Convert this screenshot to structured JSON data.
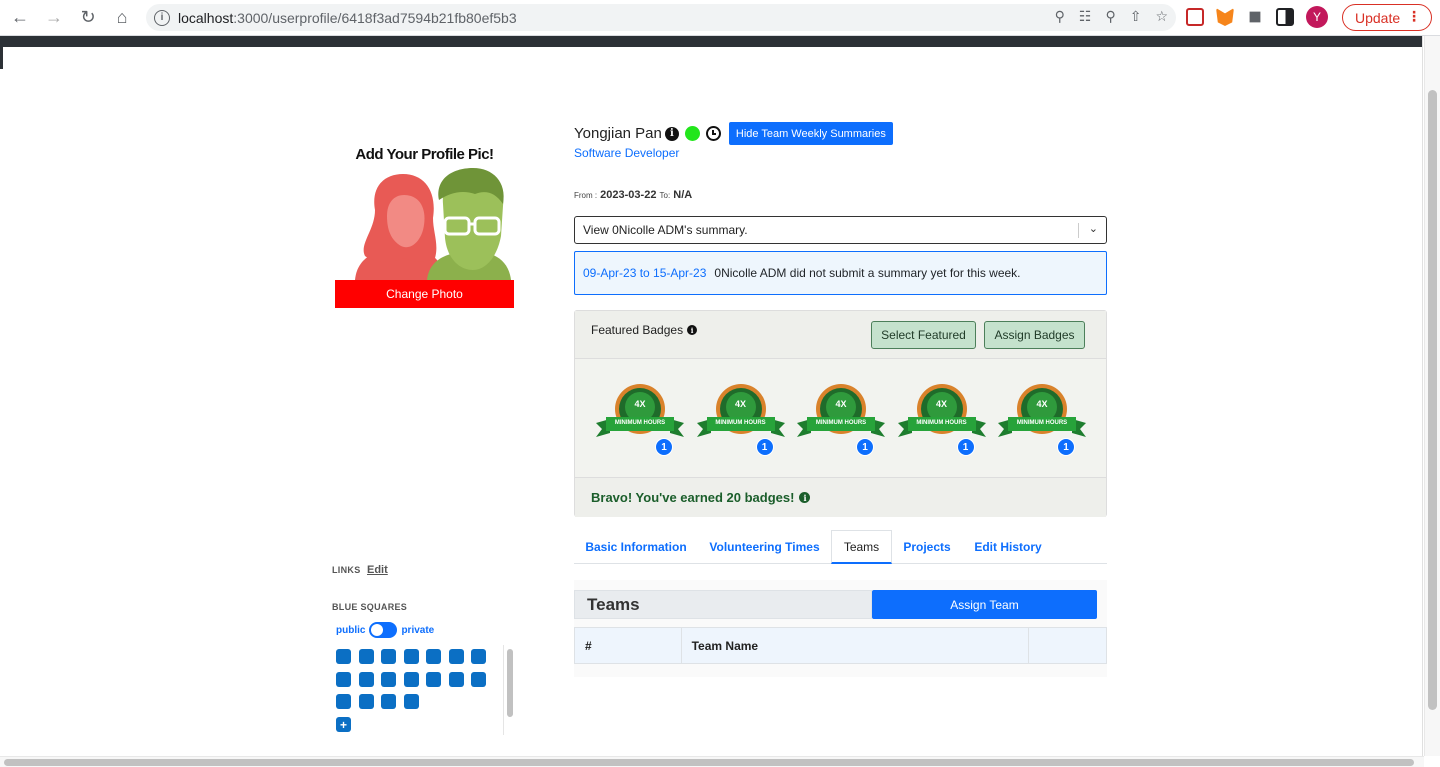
{
  "browser": {
    "url_host": "localhost",
    "url_path": ":3000/userprofile/6418f3ad7594b21fb80ef5b3",
    "avatar_letter": "Y",
    "update_label": "Update"
  },
  "profile": {
    "pic_title": "Add Your Profile Pic!",
    "change_photo_label": "Change Photo",
    "name": "Yongjian Pan",
    "role": "Software Developer",
    "hide_summaries_label": "Hide Team Weekly Summaries",
    "from_label": "From :",
    "from_date": "2023-03-22",
    "to_label": "To:",
    "to_date": "N/A",
    "status_color": "#22e61c"
  },
  "summary": {
    "select_value": "View 0Nicolle ADM's summary.",
    "range": "09-Apr-23 to 15-Apr-23",
    "message": "0Nicolle ADM did not submit a summary yet for this week."
  },
  "badges": {
    "title": "Featured Badges",
    "select_featured_label": "Select Featured",
    "assign_badges_label": "Assign Badges",
    "items": [
      {
        "multiplier": "4X",
        "ribbon": "MINIMUM HOURS",
        "count": "1"
      },
      {
        "multiplier": "4X",
        "ribbon": "MINIMUM HOURS",
        "count": "1"
      },
      {
        "multiplier": "4X",
        "ribbon": "MINIMUM HOURS",
        "count": "1"
      },
      {
        "multiplier": "4X",
        "ribbon": "MINIMUM HOURS",
        "count": "1"
      },
      {
        "multiplier": "4X",
        "ribbon": "MINIMUM HOURS",
        "count": "1"
      }
    ],
    "footer": "Bravo! You've earned 20 badges!"
  },
  "tabs": [
    {
      "label": "Basic Information"
    },
    {
      "label": "Volunteering Times"
    },
    {
      "label": "Teams"
    },
    {
      "label": "Projects"
    },
    {
      "label": "Edit History"
    }
  ],
  "teams": {
    "title": "Teams",
    "assign_label": "Assign Team",
    "columns": [
      "#",
      "Team Name",
      ""
    ]
  },
  "sidebar": {
    "links_label": "LINKS",
    "links_edit": "Edit",
    "blue_squares_label": "BLUE SQUARES",
    "public_label": "public",
    "private_label": "private",
    "add_label": "+",
    "square_count": 18
  }
}
